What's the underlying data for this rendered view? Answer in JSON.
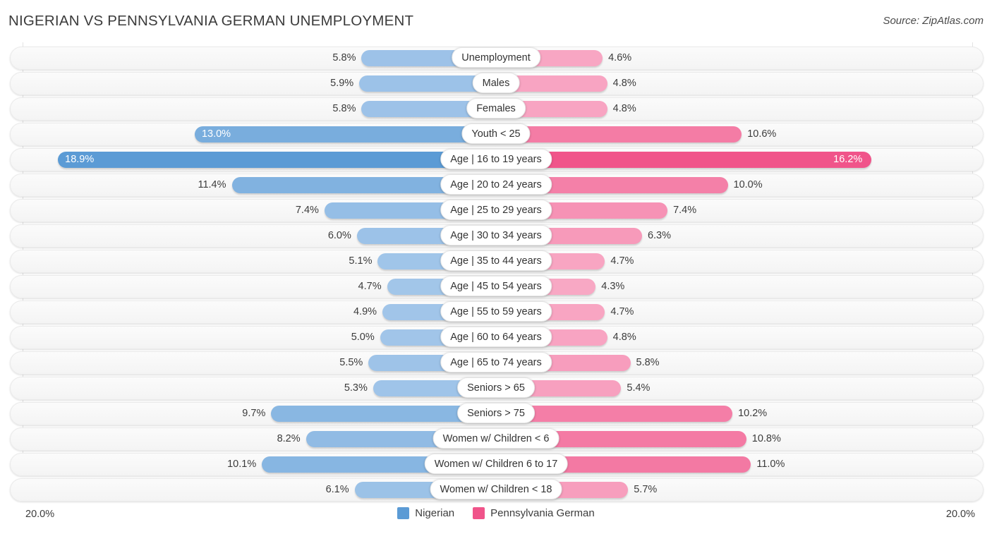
{
  "header": {
    "title": "NIGERIAN VS PENNSYLVANIA GERMAN UNEMPLOYMENT",
    "source": "Source: ZipAtlas.com"
  },
  "axis": {
    "left_end": "20.0%",
    "right_end": "20.0%",
    "max": 20.0
  },
  "legend": {
    "items": [
      {
        "label": "Nigerian",
        "color": "#5b9bd5"
      },
      {
        "label": "Pennsylvania German",
        "color": "#f0548a"
      }
    ]
  },
  "colors": {
    "left_light": "#a4c7ea",
    "left_dark": "#5b9bd5",
    "right_light": "#f8a8c4",
    "right_dark": "#f0548a",
    "track": "#f6f6f6",
    "gridline": "#e3e3e3"
  },
  "chart_data": {
    "type": "bar",
    "orientation": "horizontal-diverging",
    "title": "NIGERIAN VS PENNSYLVANIA GERMAN UNEMPLOYMENT",
    "xlabel": "",
    "ylabel": "",
    "xlim": [
      20.0,
      20.0
    ],
    "grid": true,
    "legend_position": "bottom-center",
    "categories": [
      "Unemployment",
      "Males",
      "Females",
      "Youth < 25",
      "Age | 16 to 19 years",
      "Age | 20 to 24 years",
      "Age | 25 to 29 years",
      "Age | 30 to 34 years",
      "Age | 35 to 44 years",
      "Age | 45 to 54 years",
      "Age | 55 to 59 years",
      "Age | 60 to 64 years",
      "Age | 65 to 74 years",
      "Seniors > 65",
      "Seniors > 75",
      "Women w/ Children < 6",
      "Women w/ Children 6 to 17",
      "Women w/ Children < 18"
    ],
    "series": [
      {
        "name": "Nigerian",
        "values": [
          5.8,
          5.9,
          5.8,
          13.0,
          18.9,
          11.4,
          7.4,
          6.0,
          5.1,
          4.7,
          4.9,
          5.0,
          5.5,
          5.3,
          9.7,
          8.2,
          10.1,
          6.1
        ],
        "labels": [
          "5.8%",
          "5.9%",
          "5.8%",
          "13.0%",
          "18.9%",
          "11.4%",
          "7.4%",
          "6.0%",
          "5.1%",
          "4.7%",
          "4.9%",
          "5.0%",
          "5.5%",
          "5.3%",
          "9.7%",
          "8.2%",
          "10.1%",
          "6.1%"
        ]
      },
      {
        "name": "Pennsylvania German",
        "values": [
          4.6,
          4.8,
          4.8,
          10.6,
          16.2,
          10.0,
          7.4,
          6.3,
          4.7,
          4.3,
          4.7,
          4.8,
          5.8,
          5.4,
          10.2,
          10.8,
          11.0,
          5.7
        ],
        "labels": [
          "4.6%",
          "4.8%",
          "4.8%",
          "10.6%",
          "16.2%",
          "10.0%",
          "7.4%",
          "6.3%",
          "4.7%",
          "4.3%",
          "4.7%",
          "4.8%",
          "5.8%",
          "5.4%",
          "10.2%",
          "10.8%",
          "11.0%",
          "5.7%"
        ]
      }
    ]
  }
}
